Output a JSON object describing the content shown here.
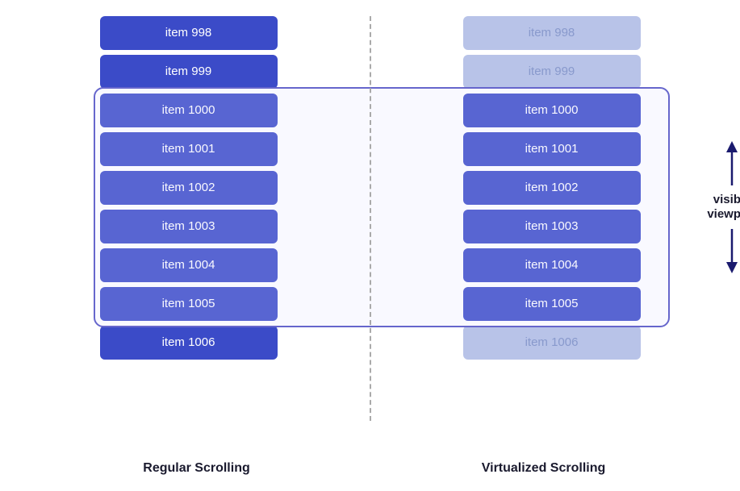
{
  "diagram": {
    "left_label": "Regular Scrolling",
    "right_label": "Virtualized Scrolling",
    "viewport_label_line1": "visible",
    "viewport_label_line2": "viewport",
    "items": [
      {
        "id": "item-998",
        "label": "item 998"
      },
      {
        "id": "item-999",
        "label": "item 999"
      },
      {
        "id": "item-1000",
        "label": "item 1000"
      },
      {
        "id": "item-1001",
        "label": "item 1001"
      },
      {
        "id": "item-1002",
        "label": "item 1002"
      },
      {
        "id": "item-1003",
        "label": "item 1003"
      },
      {
        "id": "item-1004",
        "label": "item 1004"
      },
      {
        "id": "item-1005",
        "label": "item 1005"
      },
      {
        "id": "item-1006",
        "label": "item 1006"
      }
    ],
    "faded_indices": [
      0,
      1,
      8
    ],
    "viewport_start": 2,
    "viewport_end": 7
  }
}
